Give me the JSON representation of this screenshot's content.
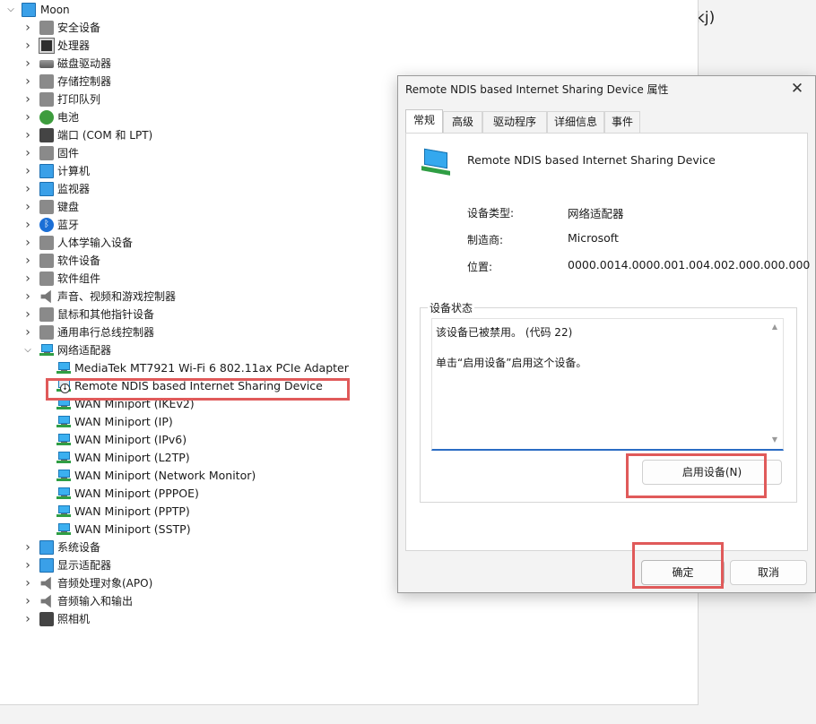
{
  "background": {
    "partial_text": "kj)"
  },
  "tree": {
    "root": {
      "label": "Moon",
      "icon": "computer-icon"
    },
    "categories": [
      {
        "label": "安全设备",
        "icon": "security-device-icon",
        "style": "ic-gray"
      },
      {
        "label": "处理器",
        "icon": "processor-chip-icon",
        "style": "ic-chip"
      },
      {
        "label": "磁盘驱动器",
        "icon": "disk-drive-icon",
        "style": "ic-disk"
      },
      {
        "label": "存储控制器",
        "icon": "storage-controller-icon",
        "style": "ic-gray"
      },
      {
        "label": "打印队列",
        "icon": "printer-icon",
        "style": "ic-gray"
      },
      {
        "label": "电池",
        "icon": "battery-icon",
        "style": "ic-green"
      },
      {
        "label": "端口 (COM 和 LPT)",
        "icon": "port-icon",
        "style": "ic-dark"
      },
      {
        "label": "固件",
        "icon": "firmware-icon",
        "style": "ic-gray"
      },
      {
        "label": "计算机",
        "icon": "computer-icon",
        "style": "ic-monitor"
      },
      {
        "label": "监视器",
        "icon": "monitor-icon",
        "style": "ic-monitor"
      },
      {
        "label": "键盘",
        "icon": "keyboard-icon",
        "style": "ic-gray"
      },
      {
        "label": "蓝牙",
        "icon": "bluetooth-icon",
        "style": "ic-bt"
      },
      {
        "label": "人体学输入设备",
        "icon": "hid-icon",
        "style": "ic-gray"
      },
      {
        "label": "软件设备",
        "icon": "software-device-icon",
        "style": "ic-gray"
      },
      {
        "label": "软件组件",
        "icon": "software-component-icon",
        "style": "ic-gray"
      },
      {
        "label": "声音、视频和游戏控制器",
        "icon": "speaker-icon",
        "style": "ic-speaker"
      },
      {
        "label": "鼠标和其他指针设备",
        "icon": "mouse-icon",
        "style": "ic-gray"
      },
      {
        "label": "通用串行总线控制器",
        "icon": "usb-icon",
        "style": "ic-gray"
      }
    ],
    "network": {
      "label": "网络适配器",
      "icon": "network-adapter-icon",
      "children": [
        {
          "label": "MediaTek MT7921 Wi-Fi 6 802.11ax PCIe Adapter",
          "disabled": false
        },
        {
          "label": "Remote NDIS based Internet Sharing Device",
          "disabled": true
        },
        {
          "label": "WAN Miniport (IKEv2)",
          "disabled": false
        },
        {
          "label": "WAN Miniport (IP)",
          "disabled": false
        },
        {
          "label": "WAN Miniport (IPv6)",
          "disabled": false
        },
        {
          "label": "WAN Miniport (L2TP)",
          "disabled": false
        },
        {
          "label": "WAN Miniport (Network Monitor)",
          "disabled": false
        },
        {
          "label": "WAN Miniport (PPPOE)",
          "disabled": false
        },
        {
          "label": "WAN Miniport (PPTP)",
          "disabled": false
        },
        {
          "label": "WAN Miniport (SSTP)",
          "disabled": false
        }
      ]
    },
    "after": [
      {
        "label": "系统设备",
        "icon": "system-device-icon",
        "style": "ic-monitor"
      },
      {
        "label": "显示适配器",
        "icon": "display-adapter-icon",
        "style": "ic-monitor"
      },
      {
        "label": "音频处理对象(APO)",
        "icon": "speaker-icon",
        "style": "ic-speaker"
      },
      {
        "label": "音频输入和输出",
        "icon": "speaker-icon",
        "style": "ic-speaker"
      },
      {
        "label": "照相机",
        "icon": "camera-icon",
        "style": "ic-dark"
      }
    ]
  },
  "dialog": {
    "title": "Remote NDIS based Internet Sharing Device 属性",
    "close_glyph": "✕",
    "tabs": [
      "常规",
      "高级",
      "驱动程序",
      "详细信息",
      "事件"
    ],
    "active_tab": 0,
    "device_name": "Remote NDIS based Internet Sharing Device",
    "properties": [
      {
        "label": "设备类型:",
        "value": "网络适配器"
      },
      {
        "label": "制造商:",
        "value": "Microsoft"
      },
      {
        "label": "位置:",
        "value": "0000.0014.0000.001.004.002.000.000.000"
      }
    ],
    "status_title": "设备状态",
    "status_lines": [
      "该设备已被禁用。 (代码 22)",
      "单击“启用设备”启用这个设备。"
    ],
    "enable_button": "启用设备(N)",
    "ok_button": "确定",
    "cancel_button": "取消"
  },
  "colors": {
    "highlight_red": "#e05a5a",
    "focus_blue": "#2a6cc4"
  }
}
